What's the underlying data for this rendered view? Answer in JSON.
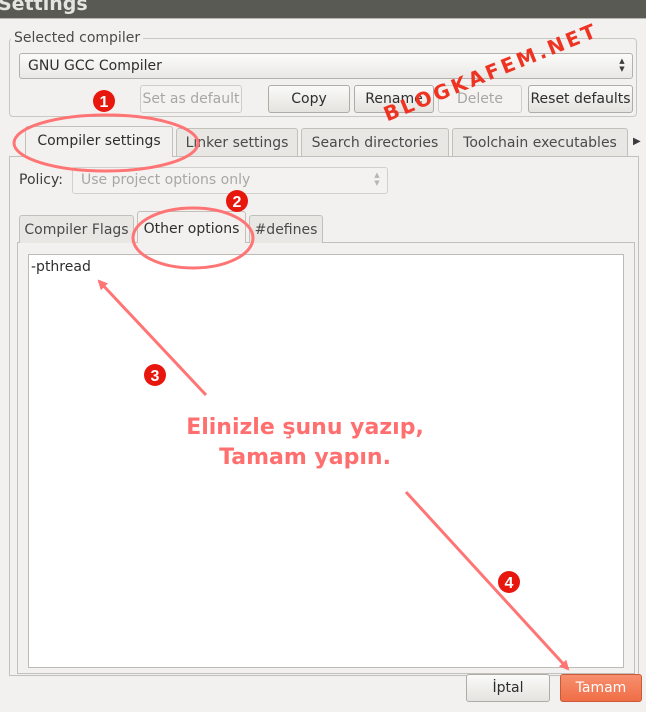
{
  "window": {
    "title": "Settings"
  },
  "selected_compiler": {
    "label": "Selected compiler",
    "value": "GNU GCC Compiler"
  },
  "compiler_buttons": {
    "set_as_default": "Set as default",
    "copy": "Copy",
    "rename": "Rename",
    "delete": "Delete",
    "reset_defaults": "Reset defaults"
  },
  "main_tabs": [
    "Compiler settings",
    "Linker settings",
    "Search directories",
    "Toolchain executables"
  ],
  "policy": {
    "label": "Policy:",
    "value": "Use project options only"
  },
  "sub_tabs": [
    "Compiler Flags",
    "Other options",
    "#defines"
  ],
  "other_options_text": "-pthread",
  "dialog_buttons": {
    "cancel": "İptal",
    "ok": "Tamam"
  },
  "annotations": {
    "markers": [
      "1",
      "2",
      "3",
      "4"
    ],
    "callout_line1": "Elinizle şunu yazıp,",
    "callout_line2": "Tamam yapın.",
    "watermark": "BLOGKAFEM.NET",
    "color": "#ff6f6f",
    "marker_color": "#e8170e"
  },
  "colors": {
    "accent": "#ef6e46",
    "window_bg": "#f2f1f0",
    "titlebar": "#5a5a55"
  }
}
